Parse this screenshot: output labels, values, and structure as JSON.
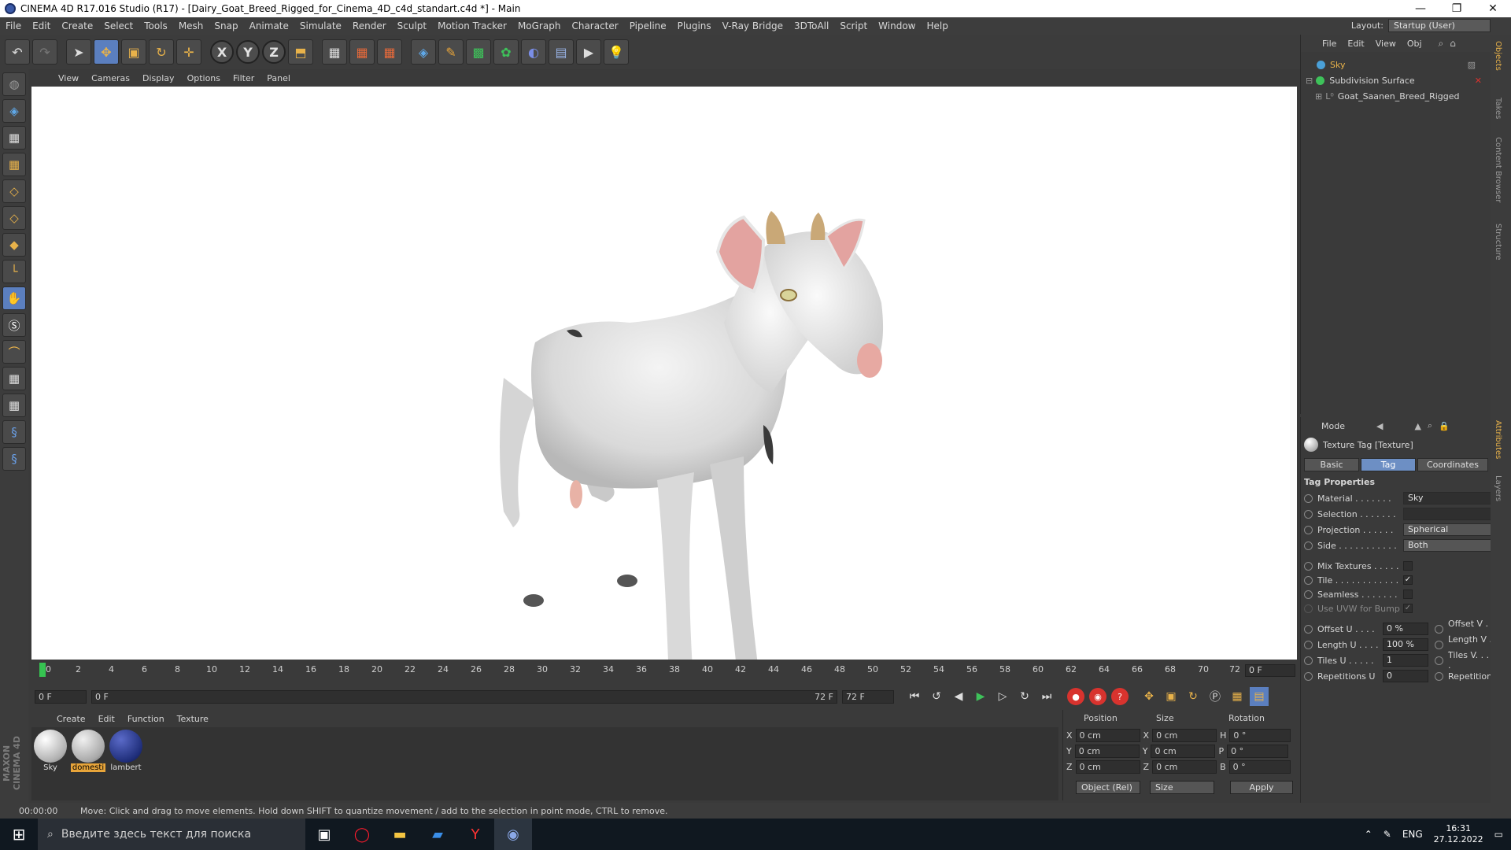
{
  "window": {
    "title": "CINEMA 4D R17.016 Studio (R17) - [Dairy_Goat_Breed_Rigged_for_Cinema_4D_c4d_standart.c4d *] - Main"
  },
  "menu": [
    "File",
    "Edit",
    "Create",
    "Select",
    "Tools",
    "Mesh",
    "Snap",
    "Animate",
    "Simulate",
    "Render",
    "Sculpt",
    "Motion Tracker",
    "MoGraph",
    "Character",
    "Pipeline",
    "Plugins",
    "V-Ray Bridge",
    "3DToAll",
    "Script",
    "Window",
    "Help"
  ],
  "layout": {
    "label": "Layout:",
    "value": "Startup (User)"
  },
  "viewport": {
    "menu": [
      "View",
      "Cameras",
      "Display",
      "Options",
      "Filter",
      "Panel"
    ]
  },
  "timeline": {
    "ticks": [
      "0",
      "2",
      "4",
      "6",
      "8",
      "10",
      "12",
      "14",
      "16",
      "18",
      "20",
      "22",
      "24",
      "26",
      "28",
      "30",
      "32",
      "34",
      "36",
      "38",
      "40",
      "42",
      "44",
      "46",
      "48",
      "50",
      "52",
      "54",
      "56",
      "58",
      "60",
      "62",
      "64",
      "66",
      "68",
      "70",
      "72"
    ],
    "current_frame": "0 F",
    "start_field": "0 F",
    "range_start": "0 F",
    "range_end": "72 F",
    "end_field": "72 F"
  },
  "material_manager": {
    "menu": [
      "Create",
      "Edit",
      "Function",
      "Texture"
    ],
    "materials": [
      {
        "name": "Sky",
        "color": "#e6e6e6"
      },
      {
        "name": "domesti",
        "color": "#d4d4d4",
        "selected": true
      },
      {
        "name": "lambert",
        "color": "#1f2e7a"
      }
    ]
  },
  "coordinates": {
    "headers": [
      "Position",
      "Size",
      "Rotation"
    ],
    "rows": [
      {
        "axis": "X",
        "pos": "0 cm",
        "saxis": "X",
        "size": "0 cm",
        "raxis": "H",
        "rot": "0 °"
      },
      {
        "axis": "Y",
        "pos": "0 cm",
        "saxis": "Y",
        "size": "0 cm",
        "raxis": "P",
        "rot": "0 °"
      },
      {
        "axis": "Z",
        "pos": "0 cm",
        "saxis": "Z",
        "size": "0 cm",
        "raxis": "B",
        "rot": "0 °"
      }
    ],
    "mode_dropdown": "Object (Rel)",
    "size_dropdown": "Size",
    "apply": "Apply"
  },
  "object_manager": {
    "menu": [
      "File",
      "Edit",
      "View",
      "Obj"
    ],
    "objects": [
      {
        "name": "Sky",
        "color": "#4aa0d8",
        "selected": true
      },
      {
        "name": "Subdivision Surface",
        "color": "#3ec25a"
      },
      {
        "name": "Goat_Saanen_Breed_Rigged",
        "color": "#9a9a9a"
      }
    ]
  },
  "attributes": {
    "mode": "Mode",
    "title": "Texture Tag [Texture]",
    "tabs": [
      "Basic",
      "Tag",
      "Coordinates"
    ],
    "section": "Tag Properties",
    "props": [
      {
        "label": "Material . . . . . . .",
        "value": "Sky"
      },
      {
        "label": "Selection . . . . . . .",
        "value": ""
      },
      {
        "label": "Projection . . . . . .",
        "value": "Spherical"
      },
      {
        "label": "Side . . . . . . . . . . .",
        "value": "Both"
      }
    ],
    "checks": [
      {
        "label": "Mix Textures . . . . .",
        "checked": false
      },
      {
        "label": "Tile . . . . . . . . . . . .",
        "checked": true
      },
      {
        "label": "Seamless . . . . . . .",
        "checked": false
      },
      {
        "label": "Use UVW for Bump",
        "checked": true
      }
    ],
    "pairs": [
      {
        "label": "Offset U . . . .",
        "value": "0 %",
        "right": "Offset V . ."
      },
      {
        "label": "Length U . . . .",
        "value": "100 %",
        "right": "Length V . ."
      },
      {
        "label": "Tiles U . . . . .",
        "value": "1",
        "right": "Tiles V. . . ."
      },
      {
        "label": "Repetitions U",
        "value": "0",
        "right": "Repetitions"
      }
    ]
  },
  "right_tabs": [
    "Objects",
    "Takes",
    "Content Browser",
    "Structure",
    "Attributes",
    "Layers"
  ],
  "status": {
    "time": "00:00:00",
    "message": "Move: Click and drag to move elements. Hold down SHIFT to quantize movement / add to the selection in point mode, CTRL to remove."
  },
  "taskbar": {
    "search_placeholder": "Введите здесь текст для поиска",
    "lang": "ENG",
    "time": "16:31",
    "date": "27.12.2022"
  }
}
